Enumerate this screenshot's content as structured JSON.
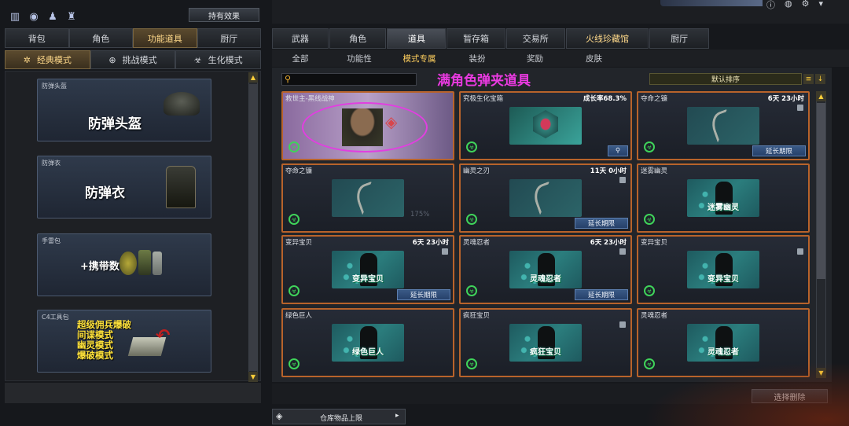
{
  "top_icons": [
    "ranking-icon",
    "eye-icon",
    "people-icon",
    "bag-icon"
  ],
  "owned_effects_button": "持有效果",
  "left_tabs": [
    "背包",
    "角色",
    "功能道具",
    "厨厅"
  ],
  "left_active_tab": 2,
  "mode_tabs": [
    {
      "icon": "✲",
      "label": "经典模式"
    },
    {
      "icon": "⊕",
      "label": "挑战模式"
    },
    {
      "icon": "☣",
      "label": "生化模式"
    }
  ],
  "left_items": [
    {
      "label": "防弹头盔",
      "title": "防弹头盔"
    },
    {
      "label": "防弹衣",
      "title": "防弹衣"
    },
    {
      "label": "手雷包",
      "title": "+携带数"
    },
    {
      "label": "C4工具包",
      "lines": [
        "超级佣兵爆破",
        "间谍模式",
        "幽灵模式",
        "爆破模式"
      ]
    }
  ],
  "right_tabs": [
    "武器",
    "角色",
    "道具",
    "暂存箱",
    "交易所",
    "火线珍藏馆",
    "厨厅"
  ],
  "right_active_tab": 2,
  "sub_tabs": [
    "全部",
    "功能性",
    "模式专属",
    "装扮",
    "奖励",
    "皮肤"
  ],
  "sub_active": 2,
  "search_placeholder": "",
  "annotation": "满角色弹夹道具",
  "sort_label": "默认排序",
  "items": [
    {
      "title": "救世主-黑线战神",
      "top_right": "",
      "name": "",
      "type": "hero",
      "extend": "",
      "lock": false,
      "highlight": true
    },
    {
      "title": "究极生化宝箱",
      "top_right": "成长率68.3%",
      "name": "",
      "type": "box",
      "extend": "",
      "lock": false,
      "search": true
    },
    {
      "title": "夺命之镰",
      "top_right": "6天 23小时",
      "name": "",
      "type": "scythe",
      "extend": "延长期限",
      "lock": true
    },
    {
      "title": "夺命之镰",
      "top_right": "",
      "name": "",
      "type": "scythe",
      "extend": "",
      "lock": false,
      "pct": "175%"
    },
    {
      "title": "幽灵之刃",
      "top_right": "11天 0小时",
      "name": "",
      "type": "scythe",
      "extend": "延长期限",
      "lock": true
    },
    {
      "title": "迷雾幽灵",
      "top_right": "",
      "name": "迷雾幽灵",
      "type": "char",
      "extend": "",
      "lock": false
    },
    {
      "title": "变异宝贝",
      "top_right": "6天 23小时",
      "name": "变异宝贝",
      "type": "char",
      "extend": "延长期限",
      "lock": true
    },
    {
      "title": "灵魂忍者",
      "top_right": "6天 23小时",
      "name": "灵魂忍者",
      "type": "char",
      "extend": "延长期限",
      "lock": true
    },
    {
      "title": "变异宝贝",
      "top_right": "",
      "name": "变异宝贝",
      "type": "char",
      "extend": "",
      "lock": true
    },
    {
      "title": "绿色巨人",
      "top_right": "",
      "name": "绿色巨人",
      "type": "char",
      "extend": "",
      "lock": false
    },
    {
      "title": "疯狂宝贝",
      "top_right": "",
      "name": "疯狂宝贝",
      "type": "char",
      "extend": "",
      "lock": true
    },
    {
      "title": "灵魂忍者",
      "top_right": "",
      "name": "灵魂忍者",
      "type": "char",
      "extend": "",
      "lock": false
    }
  ],
  "delete_button": "选择删除",
  "storage_label": "仓库物品上限"
}
